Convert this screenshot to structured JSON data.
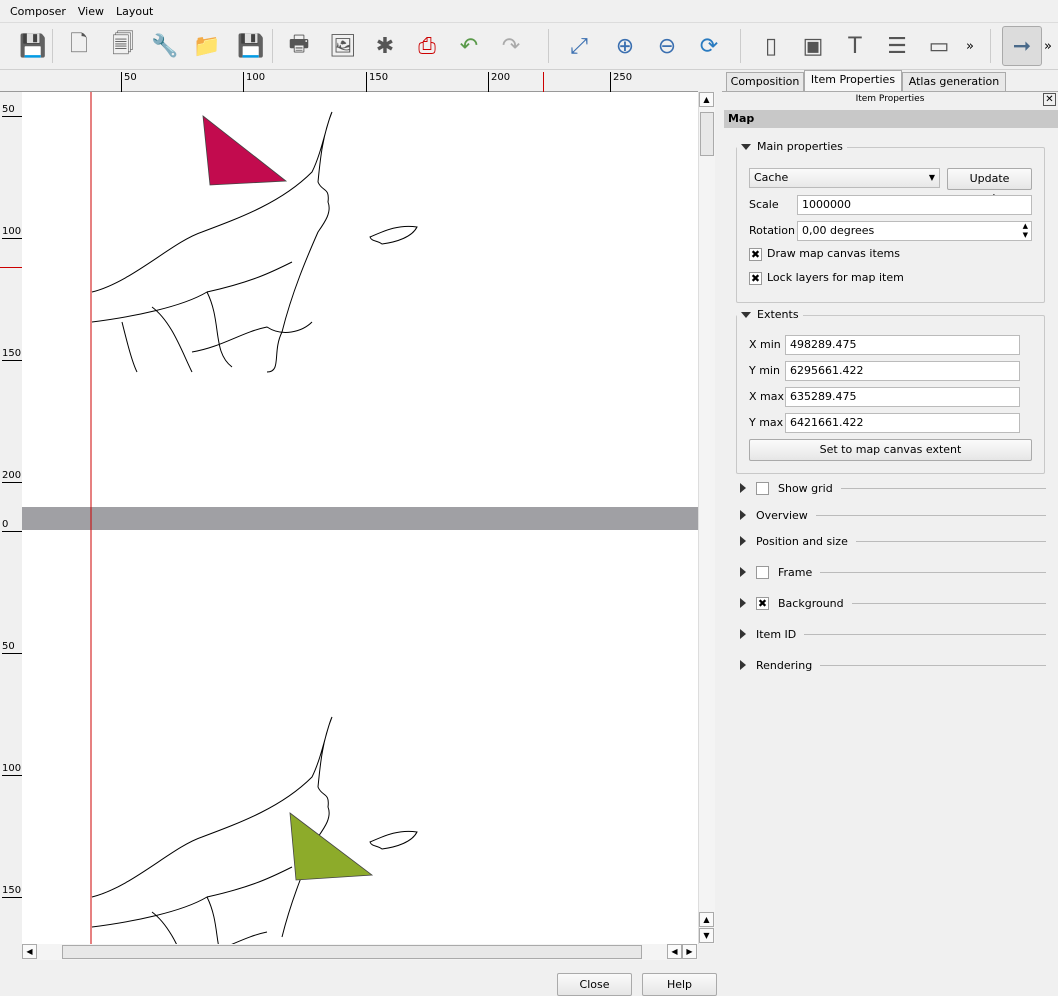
{
  "menu": [
    "Composer",
    "View",
    "Layout"
  ],
  "toolbar": {
    "icons": [
      "save-icon",
      "new-composer-icon",
      "duplicate-composer-icon",
      "composer-manager-icon",
      "open-template-icon",
      "save-as-template-icon",
      "print-icon",
      "export-image-icon",
      "export-svg-icon",
      "export-pdf-icon",
      "undo-icon",
      "redo-icon",
      "zoom-full-icon",
      "zoom-in-icon",
      "zoom-out-icon",
      "refresh-icon",
      "add-map-icon",
      "add-image-icon",
      "add-label-icon",
      "add-legend-icon",
      "add-scalebar-icon",
      "more-icon",
      "select-move-icon",
      "more-icon"
    ],
    "overflow": "»"
  },
  "ruler_top": [
    "50",
    "100",
    "150",
    "200",
    "250"
  ],
  "ruler_left": [
    "50",
    "100",
    "150",
    "200",
    "0",
    "50",
    "100",
    "150"
  ],
  "colors": {
    "triangle_top": "#c20b4e",
    "triangle_bottom": "#8dab2a",
    "guide": "#cc0000",
    "page_gap": "#a0a0a4"
  },
  "buttons": {
    "close": "Close",
    "help": "Help"
  },
  "panel": {
    "tabs": [
      "Composition",
      "Item Properties",
      "Atlas generation"
    ],
    "dock_title": "Item Properties",
    "item_type": "Map",
    "main": {
      "title": "Main properties",
      "preview_mode": "Cache",
      "update_preview": "Update preview",
      "scale_label": "Scale",
      "scale": "1000000",
      "rotation_label": "Rotation",
      "rotation": "0,00 degrees",
      "draw_canvas_items": "Draw map canvas items",
      "draw_canvas_items_checked": true,
      "lock_layers": "Lock layers for map item",
      "lock_layers_checked": true
    },
    "extents": {
      "title": "Extents",
      "xmin_label": "X min",
      "xmin": "498289.475",
      "ymin_label": "Y min",
      "ymin": "6295661.422",
      "xmax_label": "X max",
      "xmax": "635289.475",
      "ymax_label": "Y max",
      "ymax": "6421661.422",
      "set_extent": "Set to map canvas extent"
    },
    "sections": [
      {
        "label": "Show grid",
        "checkbox": true,
        "checked": false
      },
      {
        "label": "Overview"
      },
      {
        "label": "Position and size"
      },
      {
        "label": "Frame",
        "checkbox": true,
        "checked": false
      },
      {
        "label": "Background",
        "checkbox": true,
        "checked": true
      },
      {
        "label": "Item ID"
      },
      {
        "label": "Rendering"
      }
    ]
  }
}
